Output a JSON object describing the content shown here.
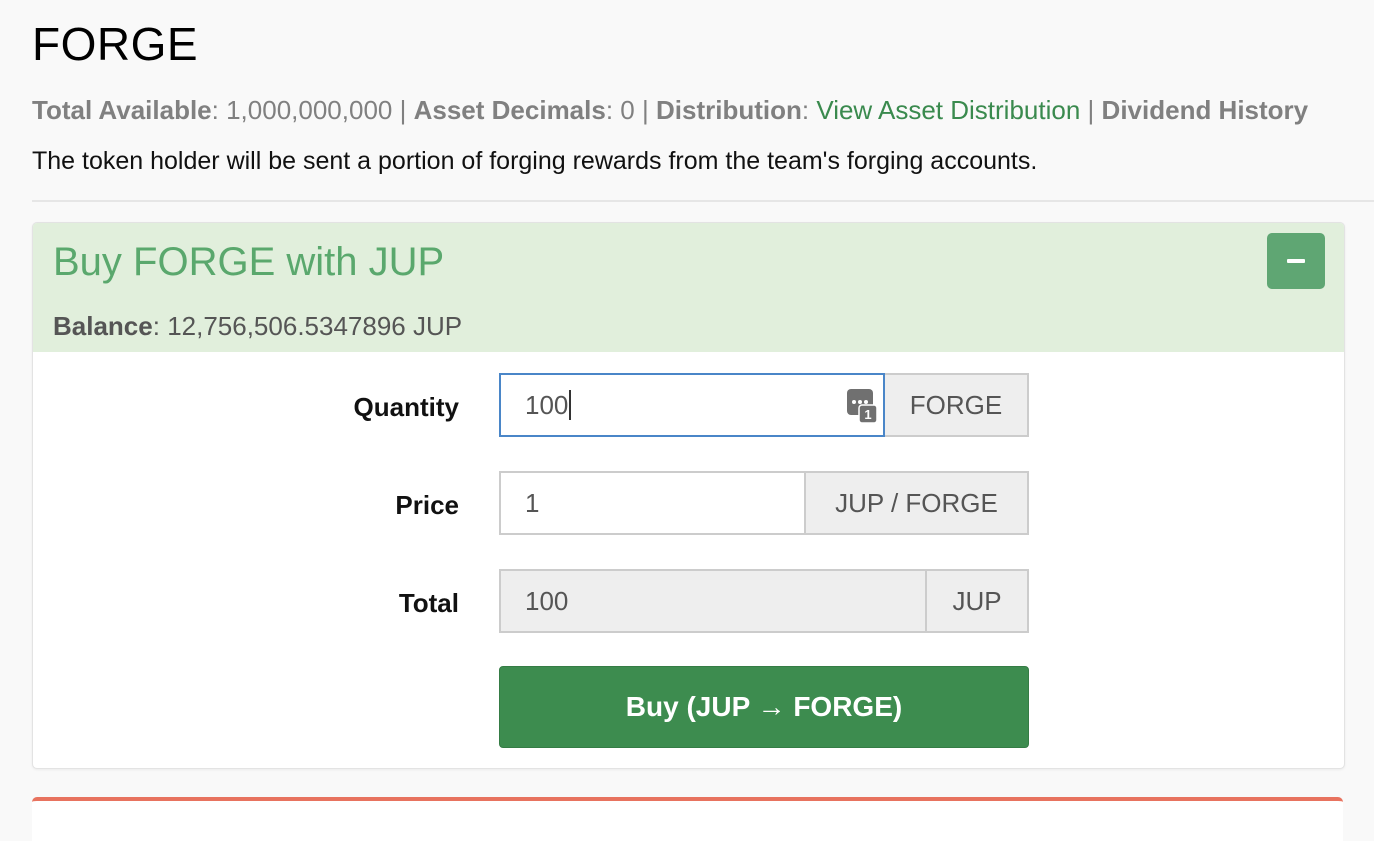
{
  "asset": {
    "title": "FORGE",
    "total_available_label": "Total Available",
    "total_available_value": "1,000,000,000",
    "asset_decimals_label": "Asset Decimals",
    "asset_decimals_value": "0",
    "distribution_label": "Distribution",
    "distribution_link": "View Asset Distribution",
    "dividend_history_label": "Dividend History",
    "separator": "|",
    "description": "The token holder will be sent a portion of forging rewards from the team's forging accounts."
  },
  "buy_panel": {
    "title": "Buy FORGE with JUP",
    "collapse_icon": "minus-icon",
    "balance_label": "Balance",
    "balance_value": "12,756,506.5347896 JUP",
    "quantity": {
      "label": "Quantity",
      "value": "100",
      "unit": "FORGE",
      "password_manager_badge": "1"
    },
    "price": {
      "label": "Price",
      "value": "1",
      "unit": "JUP / FORGE"
    },
    "total": {
      "label": "Total",
      "value": "100",
      "unit": "JUP"
    },
    "buy_button_label": "Buy (JUP → FORGE)"
  },
  "colors": {
    "accent_green": "#3d8c4f",
    "header_green_bg": "#e1efdc",
    "title_green": "#5aa86d",
    "link_green": "#3a8a4e",
    "sell_panel_red": "#e8735f"
  }
}
